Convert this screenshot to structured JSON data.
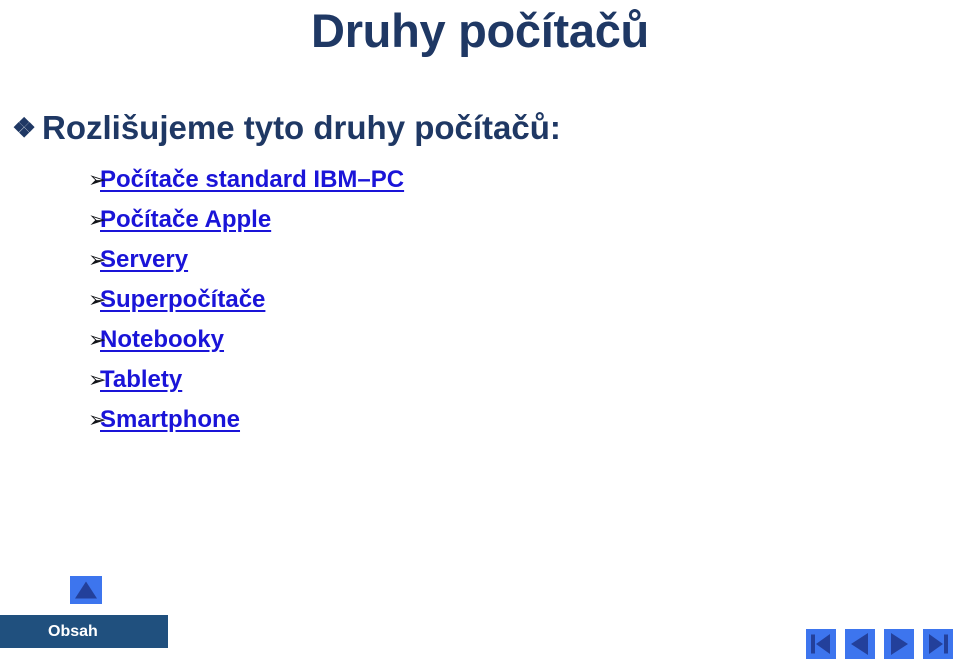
{
  "slide": {
    "title": "Druhy počítačů",
    "background_color": "#ffffff",
    "title_color": "#1f3864"
  },
  "body": {
    "lead_bullet": {
      "marker": "❖",
      "text": "Rozlišujeme tyto druhy počítačů:"
    },
    "items": [
      {
        "marker": "➢",
        "label": "Počítače standard IBM–PC"
      },
      {
        "marker": "➢",
        "label": "Počítače Apple"
      },
      {
        "marker": "➢",
        "label": "Servery"
      },
      {
        "marker": "➢",
        "label": "Superpočítače"
      },
      {
        "marker": "➢",
        "label": "Notebooky"
      },
      {
        "marker": "➢",
        "label": "Tablety"
      },
      {
        "marker": "➢",
        "label": "Smartphone"
      }
    ],
    "link_color": "#1a14d8"
  },
  "controls": {
    "up_button": {
      "icon": "triangle-up-icon"
    },
    "obsah": {
      "label": "Obsah",
      "background_color": "#20507e",
      "text_color": "#ffffff"
    },
    "nav": {
      "button_color": "#3d75ee",
      "glyph_color": "#23409b",
      "buttons": [
        {
          "icon": "first-slide-icon",
          "name": "first"
        },
        {
          "icon": "previous-slide-icon",
          "name": "previous"
        },
        {
          "icon": "next-slide-icon",
          "name": "next"
        },
        {
          "icon": "last-slide-icon",
          "name": "last"
        }
      ]
    }
  }
}
